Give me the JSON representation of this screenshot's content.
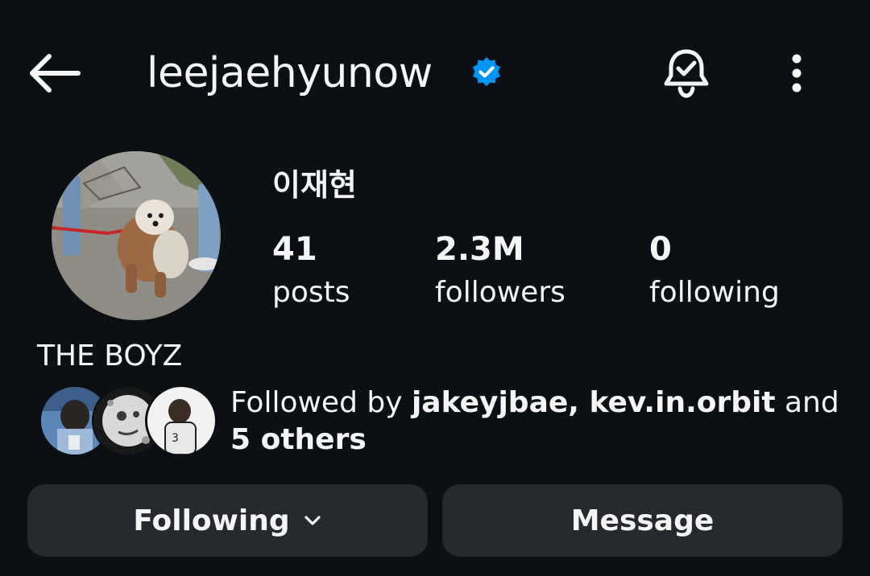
{
  "header": {
    "username": "leejaehyunow",
    "verified": true,
    "back_icon": "back-arrow-icon",
    "bell_icon": "notification-bell-icon",
    "more_icon": "more-vertical-icon"
  },
  "profile": {
    "display_name": "이재현",
    "stats": [
      {
        "value": "41",
        "label": "posts"
      },
      {
        "value": "2.3M",
        "label": "followers"
      },
      {
        "value": "0",
        "label": "following"
      }
    ],
    "bio": "THE BOYZ"
  },
  "followed_by": {
    "prefix": "Followed by ",
    "user1": "jakeyjbae",
    "sep": ", ",
    "user2": "kev.in.orbit",
    "and": " and ",
    "others": "5 others"
  },
  "actions": {
    "following_label": "Following",
    "message_label": "Message"
  },
  "colors": {
    "background": "#0c1014",
    "button_bg": "#26292e",
    "verified_blue": "#0095f6",
    "text": "#f5f5f5"
  }
}
